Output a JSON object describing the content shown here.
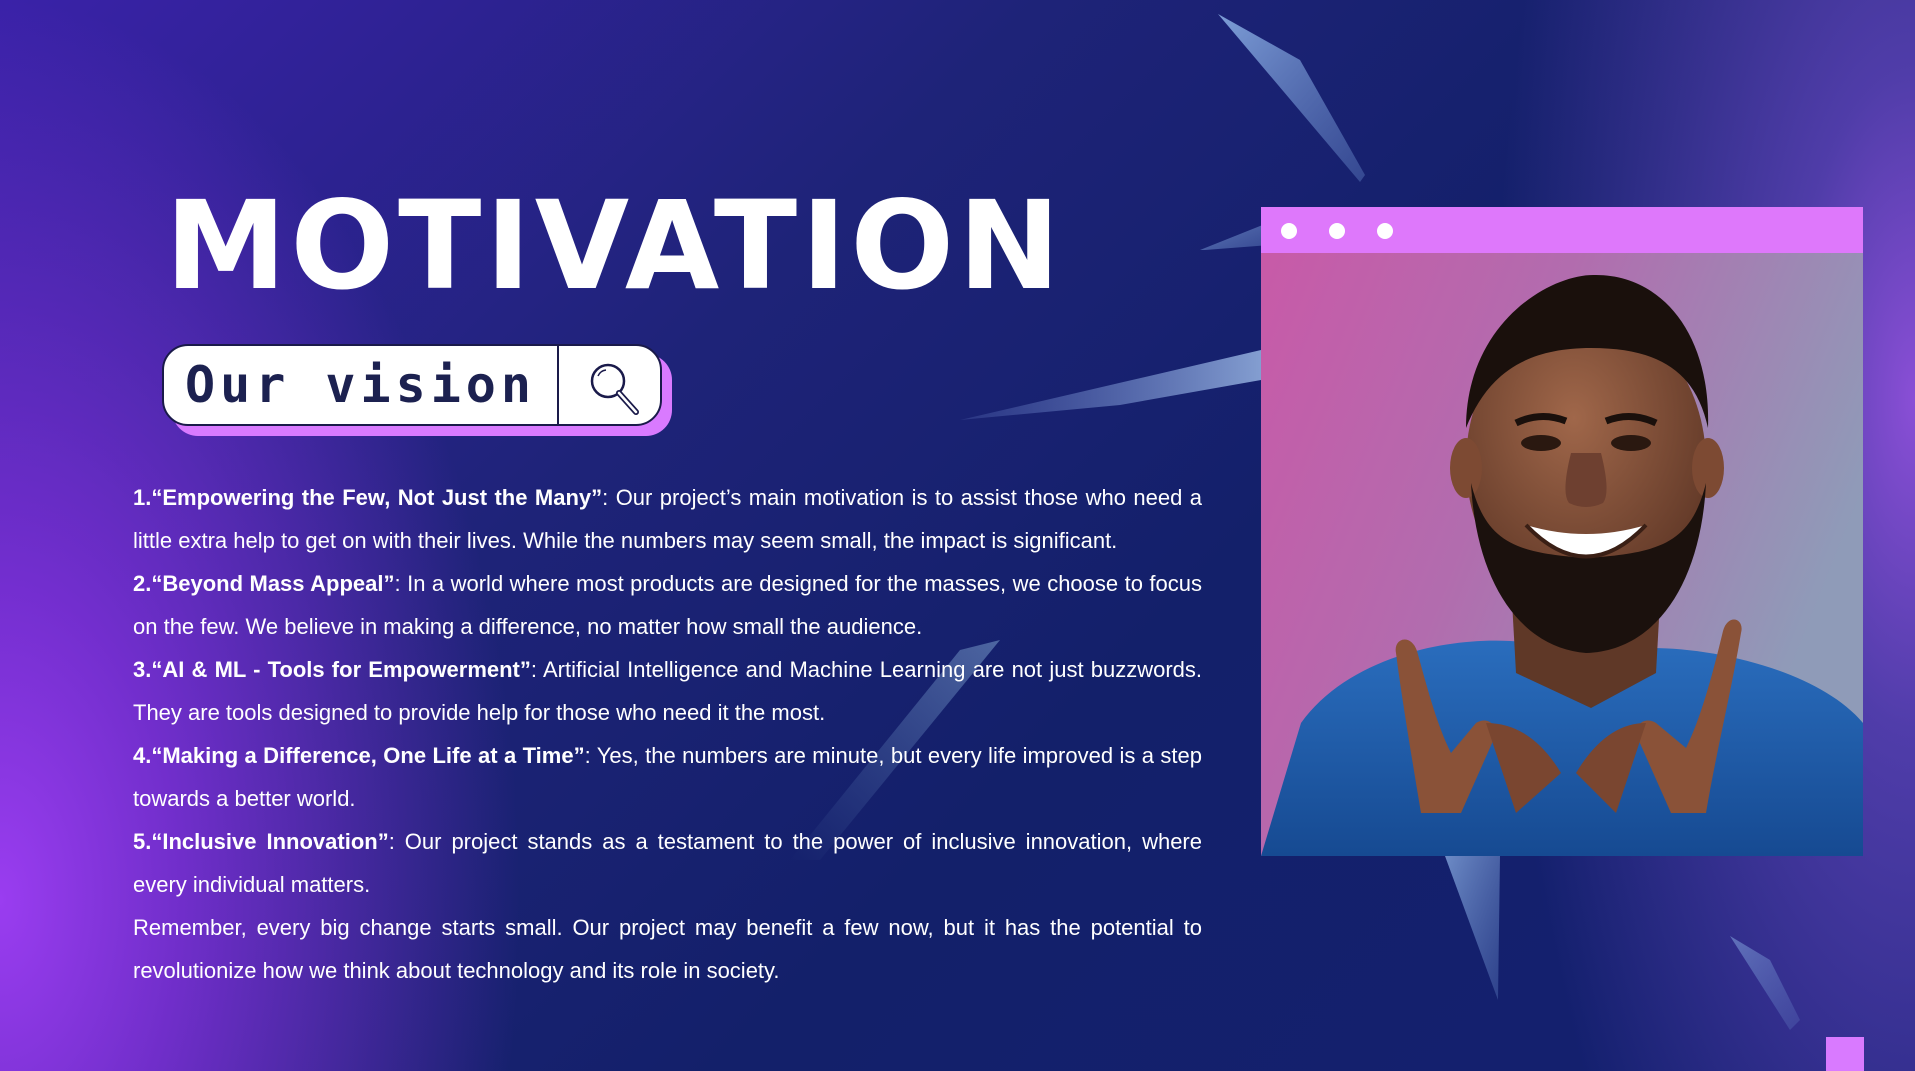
{
  "slide": {
    "title": "MOTIVATION",
    "search": {
      "label": "Our vision",
      "icon": "search-icon"
    },
    "points": [
      {
        "heading": "1.“Empowering the Few, Not Just the Many”",
        "text": ": Our project’s main motivation is to assist those who need a little extra help to get on with their lives. While the numbers may seem small, the impact is significant."
      },
      {
        "heading": "2.“Beyond Mass Appeal”",
        "text": ": In a world where most products are designed for the masses, we choose to focus on the few. We believe in making a difference, no matter how small the audience."
      },
      {
        "heading": "3.“AI & ML - Tools for Empowerment”",
        "text": ": Artificial Intelligence and Machine Learning are not just buzzwords. They are tools designed to provide help for those who need it the most."
      },
      {
        "heading": "4.“Making a Difference, One Life at a Time”",
        "text": ": Yes, the numbers are minute, but every life improved is a step towards a better world."
      },
      {
        "heading": "5.“Inclusive Innovation”",
        "text": ": Our project stands as a testament to the power of inclusive innovation, where every individual matters."
      }
    ],
    "closing": "Remember, every big change starts small. Our project may benefit a few now, but it has the potential to revolutionize how we think about technology and its role in society.",
    "photo": {
      "icon": "smiling-man-photo"
    }
  },
  "colors": {
    "accent_pink": "#de78fb",
    "background_navy": "#13206a",
    "background_purple": "#9a3df0",
    "text": "#ffffff",
    "label_text": "#1c2150"
  }
}
